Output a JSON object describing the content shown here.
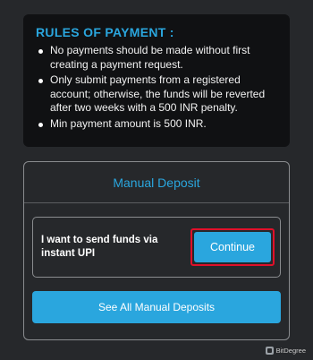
{
  "rules": {
    "title": "RULES OF PAYMENT :",
    "items": [
      "No payments should be made without first creating a payment request.",
      "Only submit payments from a registered account; otherwise, the funds will be reverted after two weeks with a 500 INR penalty.",
      "Min payment amount is 500 INR."
    ]
  },
  "deposit_card": {
    "title": "Manual Deposit",
    "upi_text": "I want to send funds via instant UPI",
    "continue_label": "Continue",
    "see_all_label": "See All Manual Deposits"
  },
  "watermark": {
    "text": "BitDegree"
  },
  "colors": {
    "accent": "#2aa6de",
    "highlight_outline": "#e0102a",
    "background": "#26282b",
    "panel": "#101113"
  }
}
